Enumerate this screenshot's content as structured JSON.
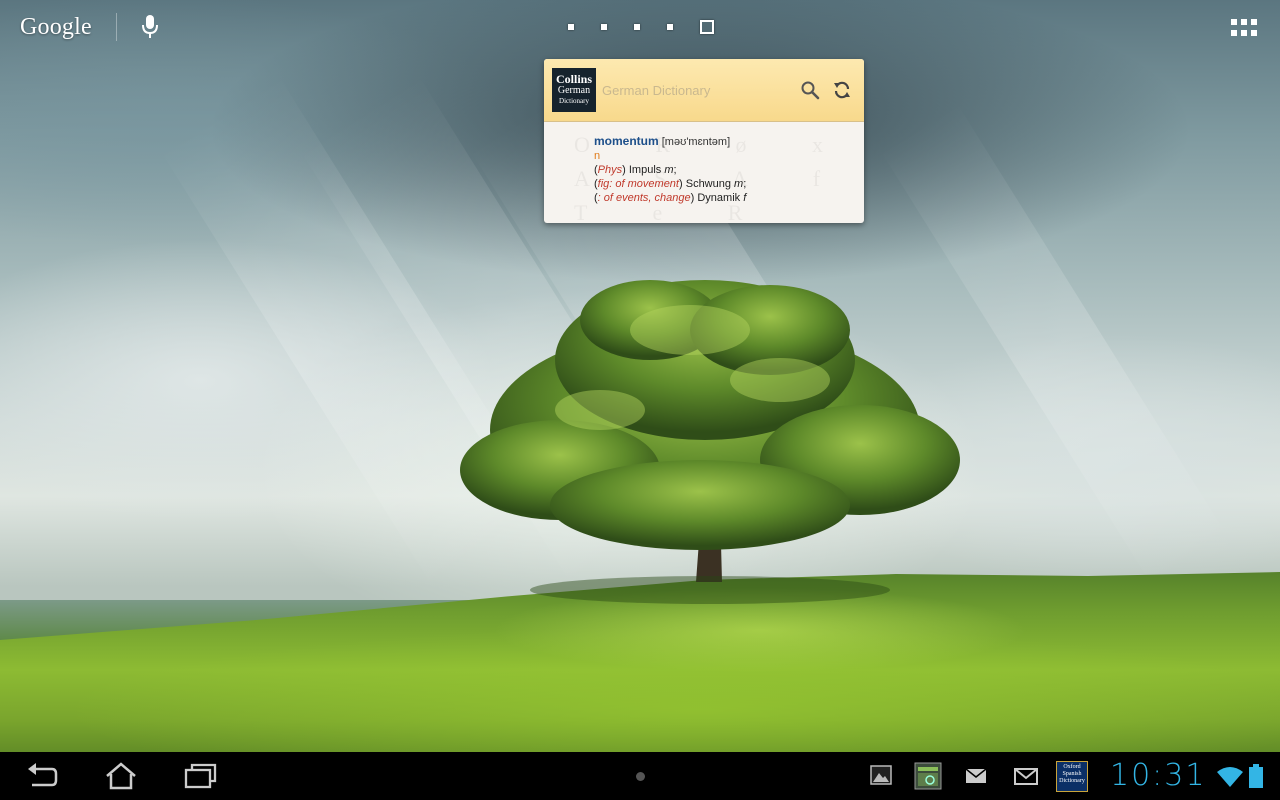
{
  "top_bar": {
    "search_logo": "Google",
    "mic_icon": "mic-icon",
    "page_dots": 5,
    "current_page": 5,
    "apps_icon": "all-apps-grid-icon"
  },
  "widget": {
    "logo_line1": "Collins",
    "logo_line2": "German",
    "logo_line3": "Dictionary",
    "title": "German Dictionary",
    "search_icon": "search-icon",
    "refresh_icon": "refresh-icon",
    "bg_letters": "O R ø x A S Λ f T e R",
    "entry": {
      "headword": "momentum",
      "pronunciation": "[məʊ'mɛntəm]",
      "part_of_speech": "n",
      "senses": [
        {
          "open": "(",
          "tag": "Phys",
          "close": ")",
          "text": " Impuls ",
          "gender": "m",
          "end": ";"
        },
        {
          "open": "(",
          "tag": "fig: of movement",
          "close": ")",
          "text": " Schwung ",
          "gender": "m",
          "end": ";"
        },
        {
          "open": "(",
          "tag": ": of events, change",
          "close": ")",
          "text": " Dynamik ",
          "gender": "f",
          "end": ""
        }
      ]
    }
  },
  "nav": {
    "back_icon": "back-icon",
    "home_icon": "home-icon",
    "recents_icon": "recent-apps-icon",
    "notifications": [
      "gallery-icon",
      "screenshot-icon",
      "email-icon",
      "gmail-icon",
      "oxford-spanish-dictionary-icon"
    ],
    "oxford_line1": "Oxford",
    "oxford_line2": "Spanish",
    "oxford_line3": "Dictionary",
    "clock": "10:31",
    "wifi_icon": "wifi-icon",
    "battery_icon": "battery-icon"
  },
  "colors": {
    "clock": "#33b5e5",
    "headword": "#1d4f8a",
    "pos": "#e07b1a",
    "tag": "#c0392b",
    "widget_header": "#f8d98c"
  }
}
